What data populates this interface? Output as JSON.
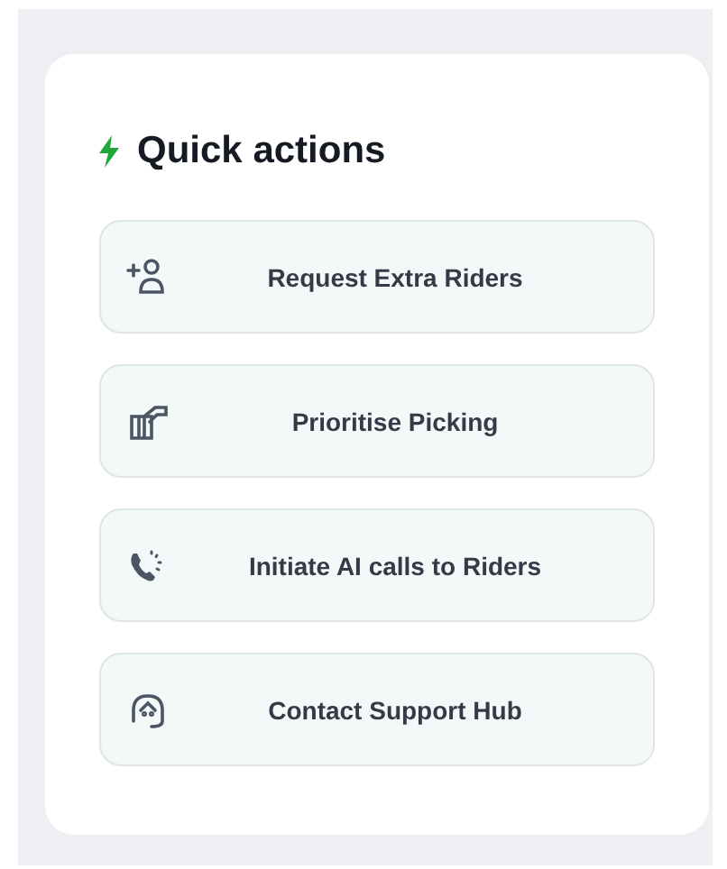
{
  "title": "Quick actions",
  "actions": [
    {
      "label": "Request Extra Riders"
    },
    {
      "label": "Prioritise Picking"
    },
    {
      "label": "Initiate AI calls to Riders"
    },
    {
      "label": "Contact Support Hub"
    }
  ]
}
